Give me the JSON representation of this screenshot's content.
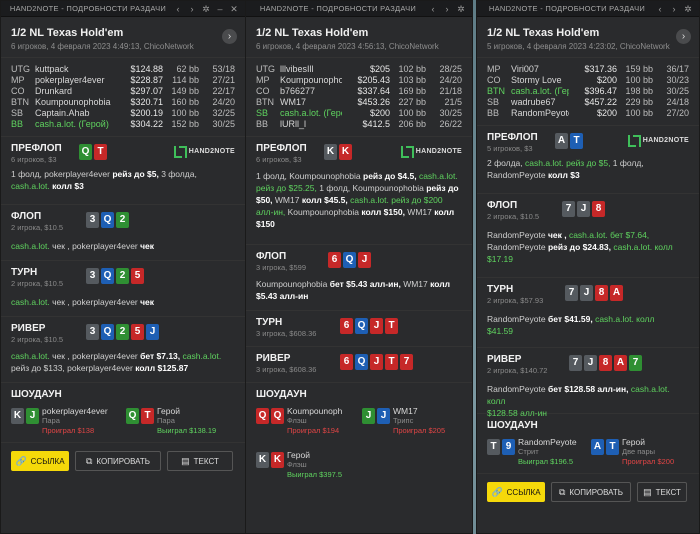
{
  "w1": {
    "title": "HAND2NOTE - ПОДРОБНОСТИ РАЗДАЧИ",
    "game": "1/2 NL Texas Hold'em",
    "meta": "6 игроков, 4 февраля 2023 4:49:13, ChicoNetwork",
    "players": [
      {
        "pos": "UTG",
        "name": "kuttpack",
        "stack": "$124.88",
        "bb": "62 bb",
        "stat": "53/18",
        "hero": false
      },
      {
        "pos": "MP",
        "name": "pokerplayer4ever",
        "stack": "$228.87",
        "bb": "114 bb",
        "stat": "27/21",
        "hero": false
      },
      {
        "pos": "CO",
        "name": "Drunkard",
        "stack": "$297.07",
        "bb": "149 bb",
        "stat": "22/17",
        "hero": false
      },
      {
        "pos": "BTN",
        "name": "Koumpounophobia",
        "stack": "$320.71",
        "bb": "160 bb",
        "stat": "24/20",
        "hero": false
      },
      {
        "pos": "SB",
        "name": "Captain.Ahab",
        "stack": "$200.19",
        "bb": "100 bb",
        "stat": "32/25",
        "hero": false
      },
      {
        "pos": "BB",
        "name": "cash.a.lot. (Герой)",
        "stack": "$304.22",
        "bb": "152 bb",
        "stat": "30/25",
        "hero": true
      }
    ],
    "preflop": {
      "name": "ПРЕФЛОП",
      "sub": "6 игроков, $3",
      "cards": [
        "Q",
        "T"
      ],
      "logo": "HAND2NOTE",
      "a1": "1 фолд, ",
      "a2": "pokerplayer4ever",
      "a3": " рейз до $5, ",
      "a4": "3 фолда,",
      "a5": "cash.a.lot.",
      "a6": " колл $3"
    },
    "flop": {
      "name": "ФЛОП",
      "sub": "2 игрока, $10.5",
      "cards": [
        "3",
        "Q",
        "2"
      ],
      "a1": "cash.a.lot.",
      "a2": " чек , pokerplayer4ever ",
      "a3": "чек"
    },
    "turn": {
      "name": "ТУРН",
      "sub": "2 игрока, $10.5",
      "cards": [
        "3",
        "Q",
        "2",
        "5"
      ],
      "a1": "cash.a.lot.",
      "a2": " чек , pokerplayer4ever ",
      "a3": "чек"
    },
    "river": {
      "name": "РИВЕР",
      "sub": "2 игрока, $10.5",
      "cards": [
        "3",
        "Q",
        "2",
        "5",
        "J"
      ],
      "a1": "cash.a.lot.",
      "a2": " чек , pokerplayer4ever ",
      "a3": "бет $7.13, ",
      "a4": "cash.a.lot.",
      "a5": " рейз до $133, pokerplayer4ever ",
      "a6": "колл $125.87"
    },
    "showdown": {
      "name": "ШОУДАУН",
      "p1": {
        "cards": [
          "K",
          "J"
        ],
        "name": "pokerplayer4ever",
        "hand": "Пара",
        "result": "Проиграл $138"
      },
      "p2": {
        "cards": [
          "Q",
          "T"
        ],
        "name": "Герой",
        "hand": "Пара",
        "result": "Выиграл $138.19"
      }
    },
    "buttons": [
      "ССЫЛКА",
      "КОПИРОВАТЬ",
      "ТЕКСТ"
    ]
  },
  "w2": {
    "title": "HAND2NOTE - ПОДРОБНОСТИ РАЗДАЧИ",
    "game": "1/2 NL Texas Hold'em",
    "meta": "6 игроков, 4 февраля 2023 4:56:13, ChicoNetwork",
    "players": [
      {
        "pos": "UTG",
        "name": "lllvibesIll",
        "stack": "$205",
        "bb": "102 bb",
        "stat": "28/25",
        "hero": false
      },
      {
        "pos": "MP",
        "name": "Koumpounophobia",
        "stack": "$205.43",
        "bb": "103 bb",
        "stat": "24/20",
        "hero": false
      },
      {
        "pos": "CO",
        "name": "b766277",
        "stack": "$337.64",
        "bb": "169 bb",
        "stat": "21/18",
        "hero": false
      },
      {
        "pos": "BTN",
        "name": "WM17",
        "stack": "$453.26",
        "bb": "227 bb",
        "stat": "21/5",
        "hero": false
      },
      {
        "pos": "SB",
        "name": "cash.a.lot. (Герой)",
        "stack": "$200",
        "bb": "100 bb",
        "stat": "30/25",
        "hero": true
      },
      {
        "pos": "BB",
        "name": "lURll_l",
        "stack": "$412.5",
        "bb": "206 bb",
        "stat": "26/22",
        "hero": false
      }
    ],
    "preflop": {
      "name": "ПРЕФЛОП",
      "sub": "6 игроков, $3",
      "cards": [
        "K",
        "K"
      ],
      "logo": "HAND2NOTE",
      "t1": "1 фолд, Koumpounophobia ",
      "t2": "рейз до $4.5,",
      "t3": " cash.a.lot. ",
      "t4": "рейз до $25.25,",
      "t5": " 1 фолд, Koumpounophobia ",
      "t6": "рейз до $50,",
      "t7": " WM17 ",
      "t8": "колл $45.5,",
      "t9": " cash.a.lot. ",
      "t10": "рейз до $200 алл-ин,",
      "t11": " Koumpounophobia ",
      "t12": "колл $150,",
      "t13": " WM17 ",
      "t14": "колл $150"
    },
    "flop": {
      "name": "ФЛОП",
      "sub": "3 игрока, $599",
      "cards": [
        "6",
        "Q",
        "J"
      ],
      "a1": "Koumpounophobia ",
      "a2": "бет $5.43 алл-ин,",
      "a3": " WM17 ",
      "a4": "колл $5.43 алл-ин"
    },
    "turn": {
      "name": "ТУРН",
      "sub": "3 игрока, $608.36",
      "cards": [
        "6",
        "Q",
        "J",
        "T"
      ]
    },
    "river": {
      "name": "РИВЕР",
      "sub": "3 игрока, $608.36",
      "cards": [
        "6",
        "Q",
        "J",
        "T",
        "7"
      ]
    },
    "showdown": {
      "name": "ШОУДАУН",
      "p1": {
        "cards": [
          "Q",
          "Q"
        ],
        "name": "Koumpounoph",
        "hand": "Флэш",
        "result": "Проиграл $194"
      },
      "p2": {
        "cards": [
          "J",
          "J"
        ],
        "name": "WM17",
        "hand": "Трипс",
        "result": "Проиграл $205"
      },
      "p3": {
        "cards": [
          "K",
          "K"
        ],
        "name": "Герой",
        "hand": "Флэш",
        "result": "Выиграл $397.5"
      }
    }
  },
  "w3": {
    "title": "HAND2NOTE - ПОДРОБНОСТИ РАЗДАЧИ",
    "game": "1/2 NL Texas Hold'em",
    "meta": "5 игроков, 4 февраля 2023 4:23:02, ChicoNetwork",
    "players": [
      {
        "pos": "MP",
        "name": "Viri007",
        "stack": "$317.36",
        "bb": "159 bb",
        "stat": "36/17",
        "hero": false
      },
      {
        "pos": "CO",
        "name": "Stormy Love",
        "stack": "$200",
        "bb": "100 bb",
        "stat": "30/23",
        "hero": false
      },
      {
        "pos": "BTN",
        "name": "cash.a.lot. (Гер",
        "stack": "$396.47",
        "bb": "198 bb",
        "stat": "30/25",
        "hero": true
      },
      {
        "pos": "SB",
        "name": "wadrube67",
        "stack": "$457.22",
        "bb": "229 bb",
        "stat": "24/18",
        "hero": false
      },
      {
        "pos": "BB",
        "name": "RandomPeyote",
        "stack": "$200",
        "bb": "100 bb",
        "stat": "27/20",
        "hero": false
      }
    ],
    "preflop": {
      "name": "ПРЕФЛОП",
      "sub": "5 игроков, $3",
      "cards": [
        "A",
        "T"
      ],
      "logo": "HAND2NOTE",
      "a1": "2 фолда, ",
      "a2": "cash.a.lot. ",
      "a3": "рейз до $5,",
      "a4": " 1 фолд,",
      "a5": "RandomPeyote ",
      "a6": "колл $3"
    },
    "flop": {
      "name": "ФЛОП",
      "sub": "2 игрока, $10.5",
      "cards": [
        "7",
        "J",
        "8"
      ],
      "a1": "RandomPeyote ",
      "a2": "чек ,",
      "a3": " cash.a.lot. ",
      "a4": "бет $7.64,",
      "a5": "RandomPeyote ",
      "a6": "рейз до $24.83,",
      "a7": " cash.a.lot. ",
      "a8": "колл",
      "a9": "$17.19"
    },
    "turn": {
      "name": "ТУРН",
      "sub": "2 игрока, $57.93",
      "cards": [
        "7",
        "J",
        "8",
        "A"
      ],
      "a1": "RandomPeyote ",
      "a2": "бет $41.59,",
      "a3": " cash.a.lot. ",
      "a4": "колл",
      "a5": "$41.59"
    },
    "river": {
      "name": "РИВЕР",
      "sub": "2 игрока, $140.72",
      "cards": [
        "7",
        "J",
        "8",
        "A",
        "7"
      ],
      "a1": "RandomPeyote ",
      "a2": "бет $128.58 алл-ин,",
      "a3": " cash.a.lot. ",
      "a4": "колл",
      "a5": "$128.58 алл-ин"
    },
    "showdown": {
      "name": "ШОУДАУН",
      "p1": {
        "cards": [
          "T",
          "9"
        ],
        "name": "RandomPeyote",
        "hand": "Стрит",
        "result": "Выиграл $196.5"
      },
      "p2": {
        "cards": [
          "A",
          "T"
        ],
        "name": "Герой",
        "hand": "Две пары",
        "result": "Проиграл $200"
      }
    },
    "buttons": [
      "ССЫЛКА",
      "КОПИРОВАТЬ",
      "ТЕКСТ"
    ]
  },
  "nav_icon": "chevron-right",
  "tb_icons": [
    "chevron-left",
    "chevron-right",
    "gear",
    "minimize",
    "close"
  ],
  "suit_colors": {
    "hearts": "#c62828",
    "diamonds": "#1e5fb4",
    "clubs": "#2f8f33",
    "spades": "#555a5f"
  }
}
